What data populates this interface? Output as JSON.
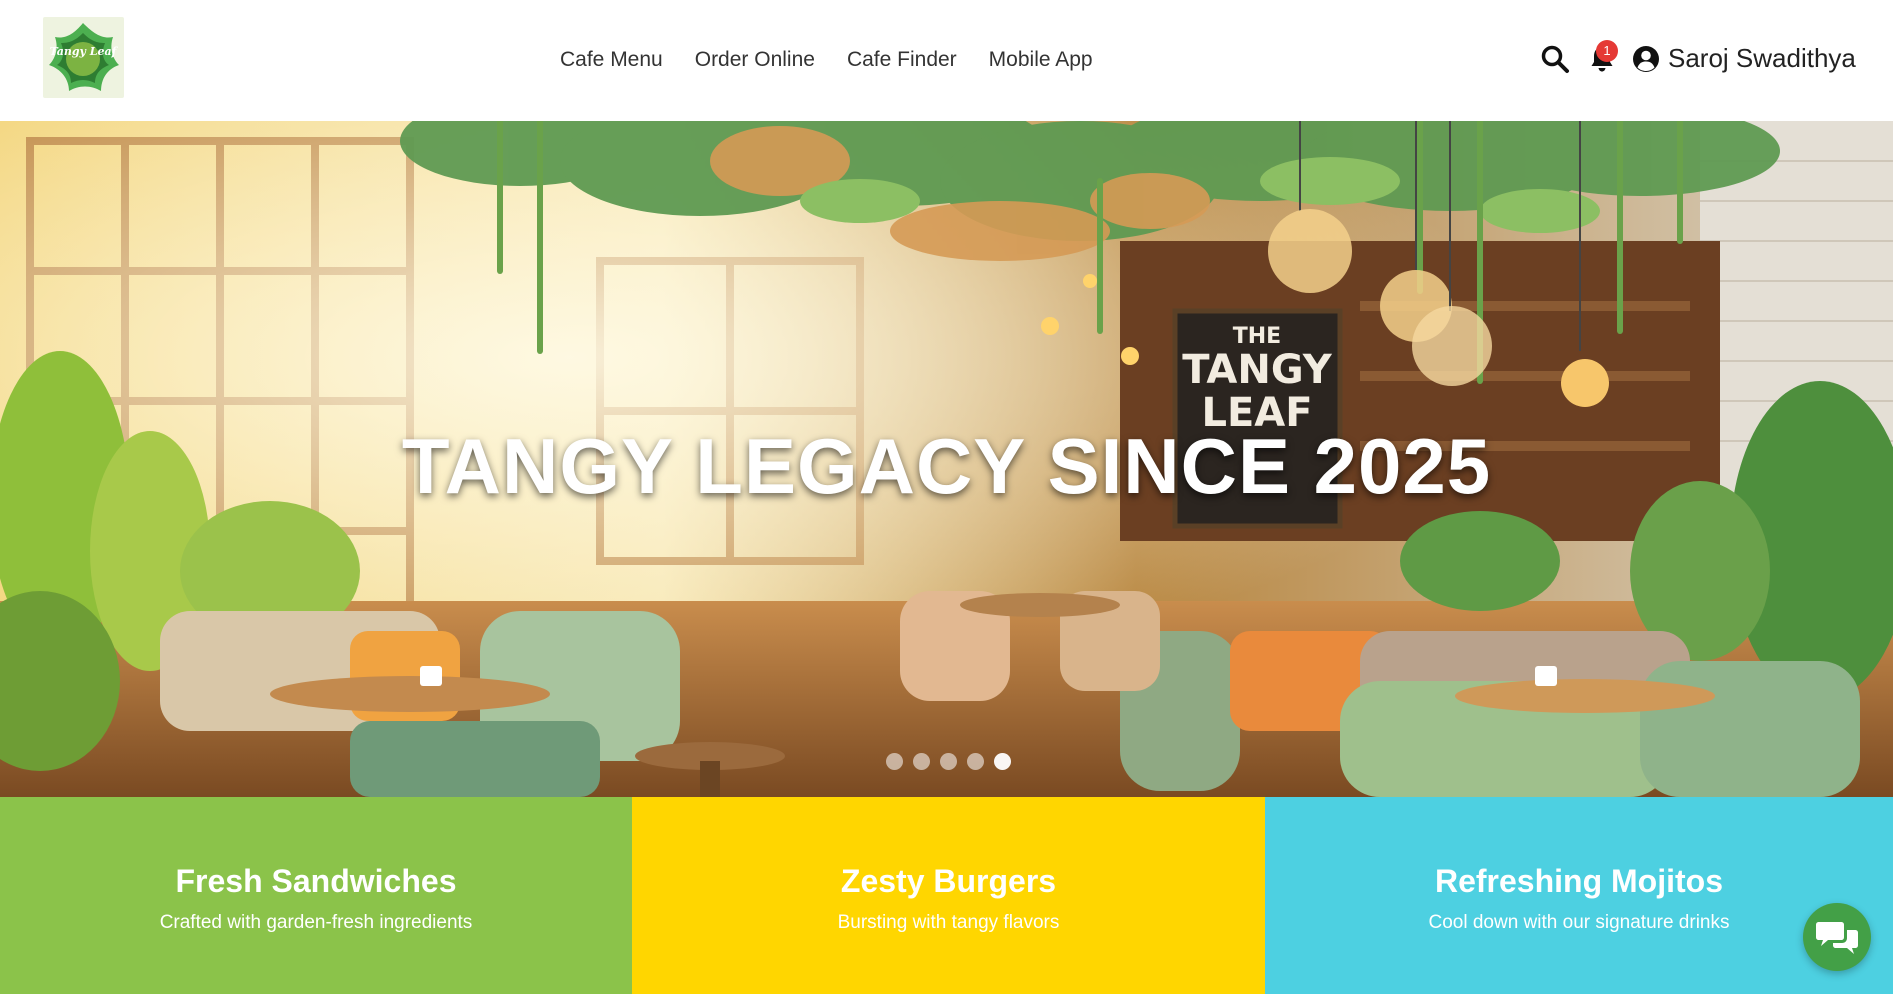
{
  "brand": {
    "logo_text": "Tangy Leaf",
    "accent": "#8bc34a"
  },
  "nav": [
    "Cafe Menu",
    "Order Online",
    "Cafe Finder",
    "Mobile App"
  ],
  "header": {
    "search_icon": "search-icon",
    "bell_icon": "bell-icon",
    "notification_count": "1",
    "user_icon": "user-circle-icon",
    "user_name": "Saroj Swadithya"
  },
  "hero": {
    "title": "TANGY LEGACY SINCE 2025",
    "sign_text": [
      "THE",
      "TANGY",
      "LEAF"
    ],
    "slide_count": 5,
    "active_slide": 5
  },
  "tiles": [
    {
      "title": "Fresh Sandwiches",
      "subtitle": "Crafted with garden-fresh ingredients",
      "color": "#8bc34a"
    },
    {
      "title": "Zesty Burgers",
      "subtitle": "Bursting with tangy flavors",
      "color": "#ffd600"
    },
    {
      "title": "Refreshing Mojitos",
      "subtitle": "Cool down with our signature drinks",
      "color": "#4dd0e1"
    }
  ],
  "chat": {
    "icon": "chat-bubbles-icon"
  }
}
